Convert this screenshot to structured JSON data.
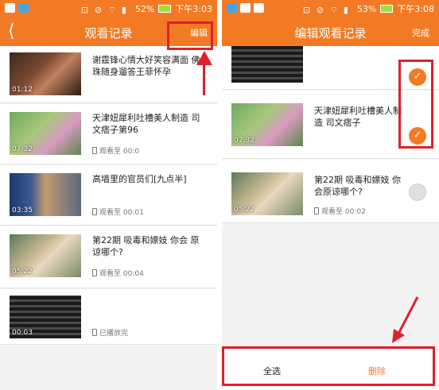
{
  "status_left": {
    "battery": "52%",
    "time": "下午3:03"
  },
  "status_right": {
    "battery": "53%",
    "time": "下午3:08"
  },
  "left_screen": {
    "back_icon": "back-arrow-icon",
    "title": "观看记录",
    "action": "编辑",
    "items": [
      {
        "title": "谢霆锋心情大好笑容满面 佛珠随身遛答王菲怀孕",
        "duration": "01:12",
        "watched": ""
      },
      {
        "title": "天津妞犀利吐槽美人制造 司文痞子第96",
        "duration": "07:32",
        "watched": "观看至 00:0"
      },
      {
        "title": "高墙里的官员们[九点半]",
        "duration": "03:35",
        "watched": "观看至 00:01"
      },
      {
        "title": "第22期 吸毒和嫖妓 你会 原谅哪个?",
        "duration": "05:22",
        "watched": "观看至 00:04"
      },
      {
        "title": "",
        "duration": "00:03",
        "watched": "已播放完"
      }
    ]
  },
  "right_screen": {
    "title": "编辑观看记录",
    "action": "完成",
    "items": [
      {
        "title": "",
        "duration": "",
        "watched": "",
        "checked": true
      },
      {
        "title": "天津妞犀利吐槽美人制造 司文痞子",
        "duration": "07:32",
        "watched": "",
        "checked": true
      },
      {
        "title": "第22期 吸毒和嫖妓 你会原谅哪个?",
        "duration": "05:22",
        "watched": "观看至 00:02",
        "checked": false
      }
    ],
    "select_all": "全选",
    "delete": "删除"
  },
  "colors": {
    "accent": "#f37a24",
    "highlight": "#e0202a"
  }
}
